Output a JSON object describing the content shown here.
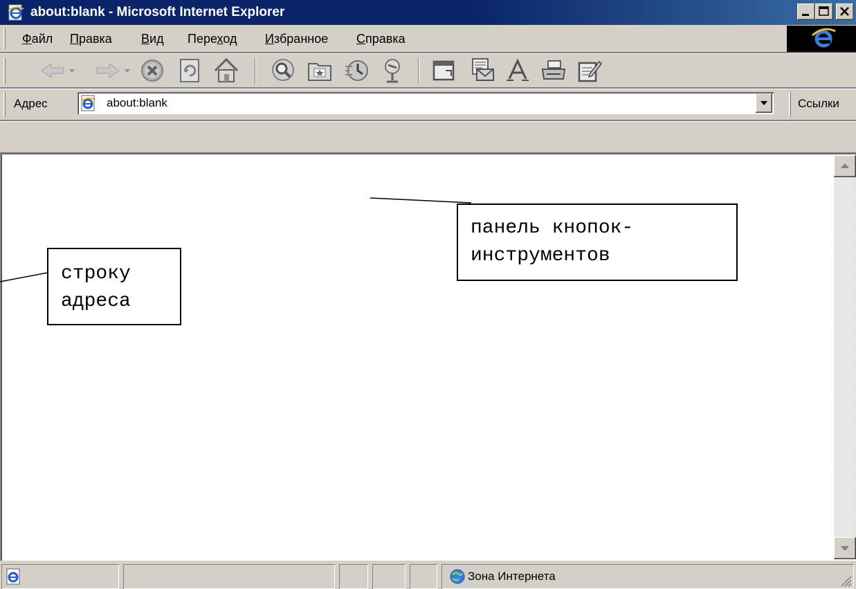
{
  "window": {
    "title": "about:blank - Microsoft Internet Explorer"
  },
  "menu": {
    "items": [
      {
        "label": "Файл",
        "accel": "Ф"
      },
      {
        "label": "Правка",
        "accel": "П"
      },
      {
        "label": "Вид",
        "accel": "В"
      },
      {
        "label": "Переход",
        "accel": "х"
      },
      {
        "label": "Избранное",
        "accel": "И"
      },
      {
        "label": "Справка",
        "accel": "С"
      }
    ]
  },
  "toolbar": {
    "buttons": [
      "back-icon",
      "forward-icon",
      "stop-icon",
      "refresh-icon",
      "home-icon",
      "search-icon",
      "favorites-icon",
      "history-icon",
      "channels-icon",
      "fullscreen-icon",
      "mail-icon",
      "font-icon",
      "print-icon",
      "edit-icon"
    ]
  },
  "address": {
    "label": "Адрес",
    "value": "about:blank",
    "links_label": "Ссылки"
  },
  "annotations": {
    "toolbar_callout": [
      "панель кнопок-",
      "инструментов"
    ],
    "address_callout": [
      "строку",
      "адреса"
    ]
  },
  "status": {
    "zone": "Зона Интернета"
  },
  "colors": {
    "titlebar": "#0a246a",
    "face": "#d4d0c8",
    "ie_blue": "#1c5bd6"
  }
}
